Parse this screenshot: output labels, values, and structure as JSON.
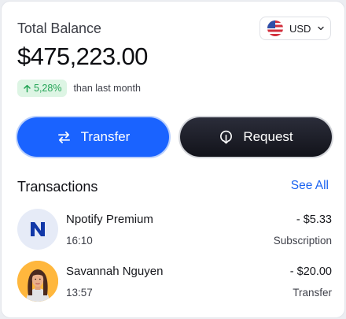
{
  "balance": {
    "label": "Total Balance",
    "amount": "$475,223.00",
    "change_percent": "5,28%",
    "change_note": "than last month",
    "change_direction": "up"
  },
  "currency": {
    "code": "USD",
    "flag_icon": "us-flag-icon"
  },
  "actions": {
    "transfer_label": "Transfer",
    "request_label": "Request"
  },
  "transactions": {
    "title": "Transactions",
    "see_all_label": "See All",
    "items": [
      {
        "name": "Npotify Premium",
        "time": "16:10",
        "amount": "- $5.33",
        "category": "Subscription",
        "icon": "npotify-logo-icon"
      },
      {
        "name": "Savannah Nguyen",
        "time": "13:57",
        "amount": "- $20.00",
        "category": "Transfer",
        "icon": "person-avatar"
      }
    ]
  },
  "colors": {
    "accent": "#1a63ff",
    "positive": "#23a455",
    "dark_button": "#1b1c24"
  }
}
